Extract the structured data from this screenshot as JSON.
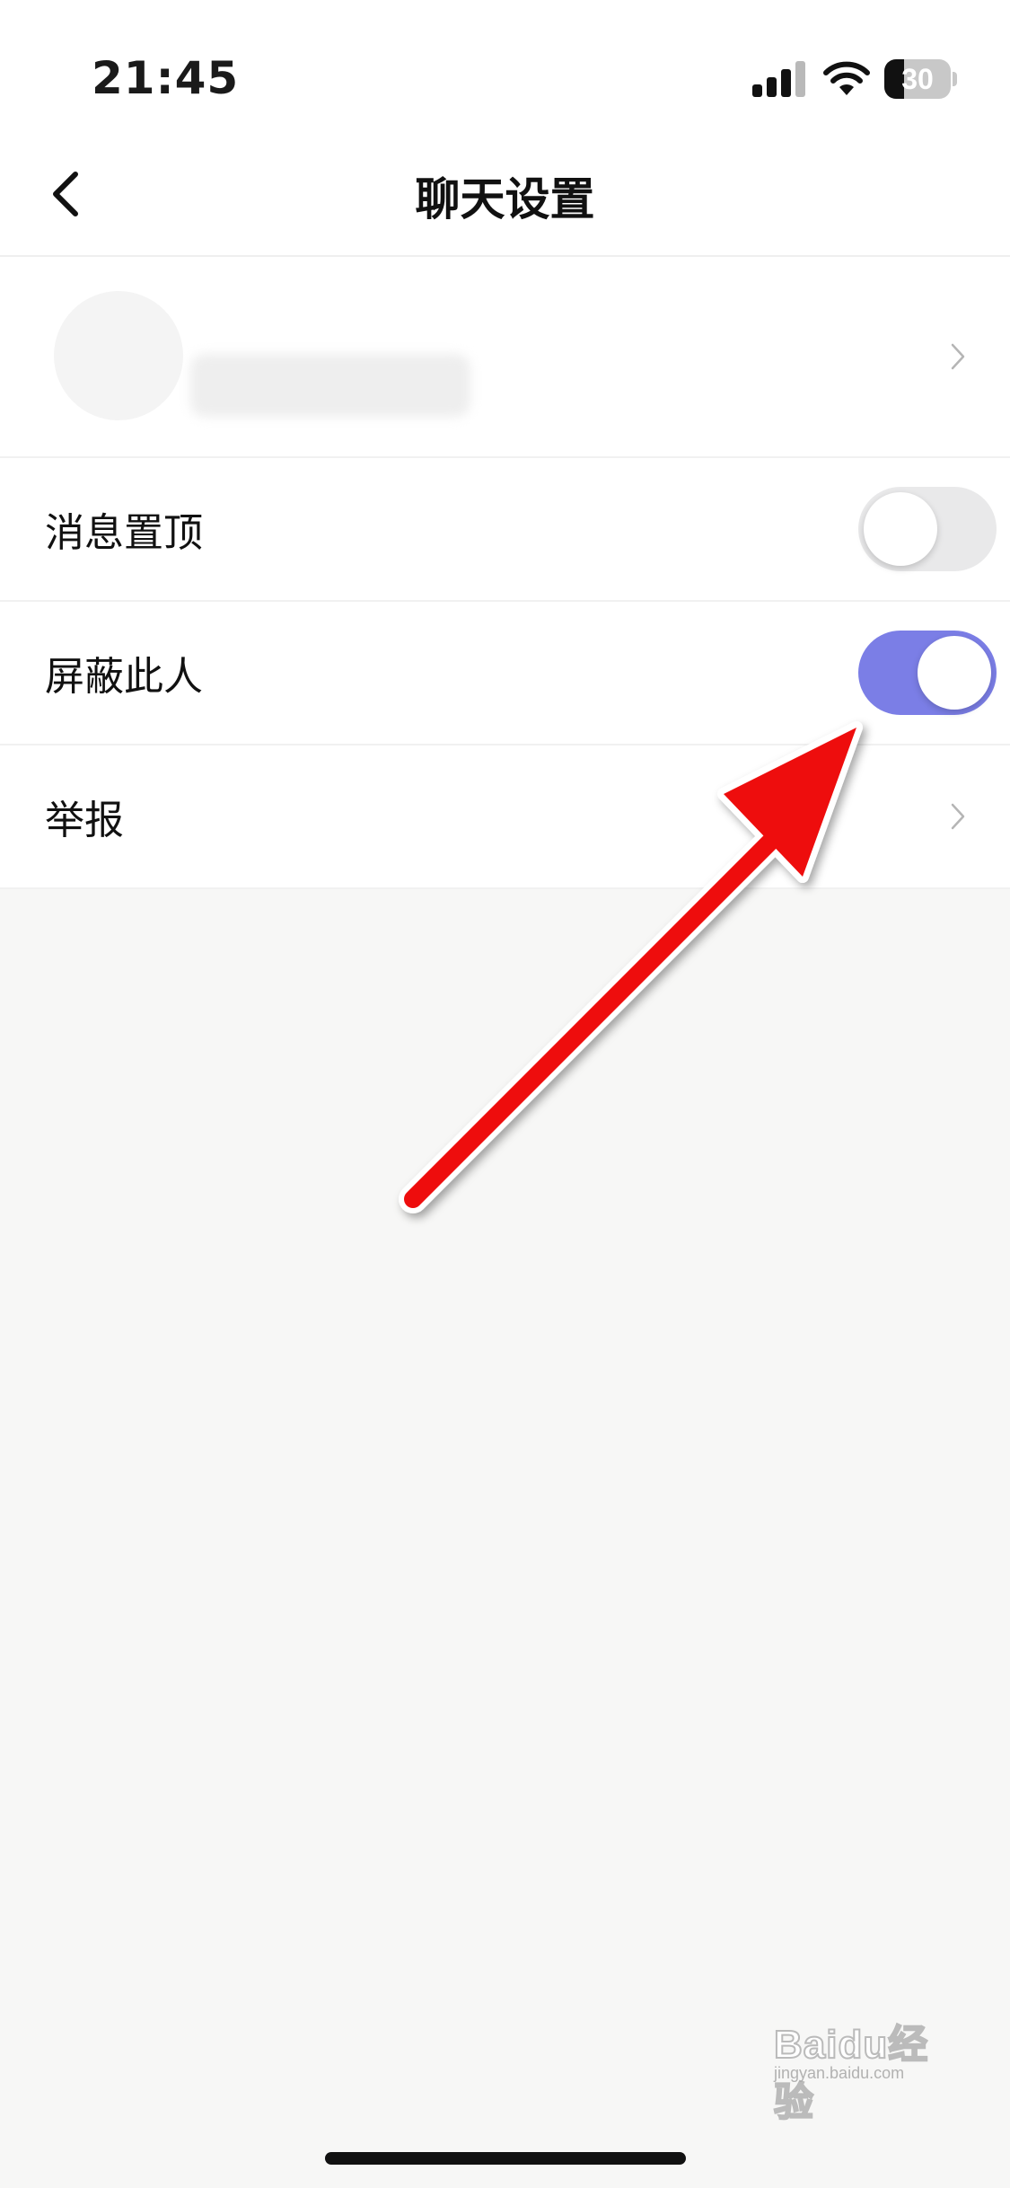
{
  "status_bar": {
    "time": "21:45",
    "battery_level": "30",
    "battery_percent": 30,
    "signal_icon": "cellular-signal-icon",
    "wifi_icon": "wifi-icon"
  },
  "nav": {
    "title": "聊天设置",
    "back_icon": "chevron-left-icon"
  },
  "profile": {
    "avatar_icon": "avatar",
    "chevron_icon": "chevron-right-icon"
  },
  "settings": [
    {
      "label": "消息置顶",
      "control": "toggle",
      "on": false
    },
    {
      "label": "屏蔽此人",
      "control": "toggle",
      "on": true
    },
    {
      "label": "举报",
      "control": "chevron"
    }
  ],
  "colors": {
    "accent": "#7b7ee6",
    "toggle_off": "#e9e9ea",
    "arrow": "#ee1111",
    "background": "#f7f7f6"
  },
  "watermark": {
    "text": "Baidu经验",
    "sub": "jingyan.baidu.com"
  }
}
